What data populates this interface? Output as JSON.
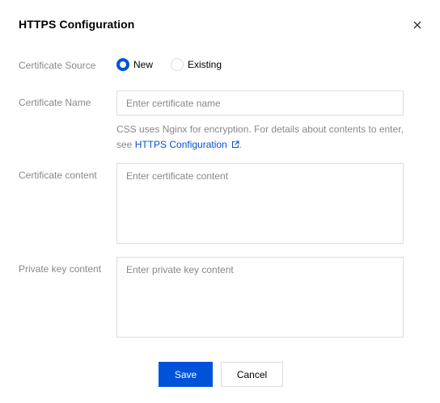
{
  "dialog": {
    "title": "HTTPS Configuration",
    "close_icon": "close-icon"
  },
  "form": {
    "certificate_source": {
      "label": "Certificate Source",
      "options": [
        "New",
        "Existing"
      ],
      "selected": "New"
    },
    "certificate_name": {
      "label": "Certificate Name",
      "value": "",
      "placeholder": "Enter certificate name"
    },
    "help": {
      "text_before": "CSS uses Nginx for encryption. For details about contents to enter, see ",
      "link_text": "HTTPS Configuration",
      "link_icon": "external-link-icon",
      "text_after": "."
    },
    "certificate_content": {
      "label": "Certificate content",
      "value": "",
      "placeholder": "Enter certificate content"
    },
    "private_key_content": {
      "label": "Private key content",
      "value": "",
      "placeholder": "Enter private key content"
    }
  },
  "footer": {
    "save_label": "Save",
    "cancel_label": "Cancel"
  },
  "colors": {
    "primary": "#0052d9",
    "label": "#888888",
    "border": "#dcdcdc"
  }
}
